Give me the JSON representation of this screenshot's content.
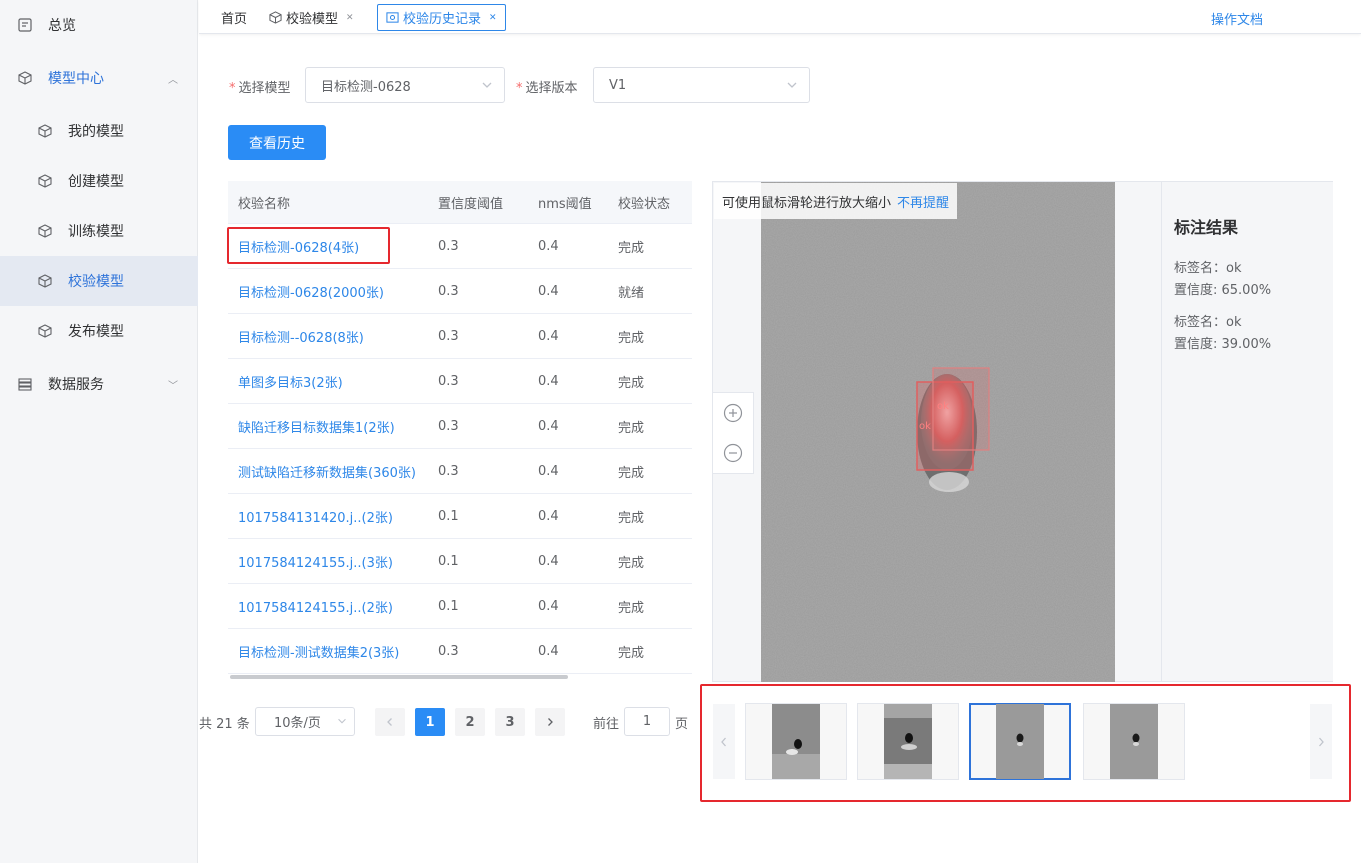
{
  "sidebar": {
    "overview": "总览",
    "model_center": "模型中心",
    "items": [
      {
        "label": "我的模型",
        "icon": "cube-icon"
      },
      {
        "label": "创建模型",
        "icon": "cube-plus-icon"
      },
      {
        "label": "训练模型",
        "icon": "cube-icon"
      },
      {
        "label": "校验模型",
        "icon": "cube-check-icon"
      },
      {
        "label": "发布模型",
        "icon": "cube-icon"
      }
    ],
    "data_service": "数据服务"
  },
  "tabs": {
    "home": "首页",
    "verify_model": "校验模型",
    "history": "校验历史记录",
    "doc_link": "操作文档"
  },
  "form": {
    "model_label": "选择模型",
    "model_value": "目标检测-0628",
    "version_label": "选择版本",
    "version_value": "V1",
    "query_button": "查看历史"
  },
  "table": {
    "headers": [
      "校验名称",
      "置信度阈值",
      "nms阈值",
      "校验状态"
    ],
    "rows": [
      {
        "name": "目标检测-0628(4张)",
        "conf": "0.3",
        "nms": "0.4",
        "status": "完成"
      },
      {
        "name": "目标检测-0628(2000张)",
        "conf": "0.3",
        "nms": "0.4",
        "status": "就绪"
      },
      {
        "name": "目标检测--0628(8张)",
        "conf": "0.3",
        "nms": "0.4",
        "status": "完成"
      },
      {
        "name": "单图多目标3(2张)",
        "conf": "0.3",
        "nms": "0.4",
        "status": "完成"
      },
      {
        "name": "缺陷迁移目标数据集1(2张)",
        "conf": "0.3",
        "nms": "0.4",
        "status": "完成"
      },
      {
        "name": "测试缺陷迁移新数据集(360张)",
        "conf": "0.3",
        "nms": "0.4",
        "status": "完成"
      },
      {
        "name": "1017584131420.j..(2张)",
        "conf": "0.1",
        "nms": "0.4",
        "status": "完成"
      },
      {
        "name": "1017584124155.j..(3张)",
        "conf": "0.1",
        "nms": "0.4",
        "status": "完成"
      },
      {
        "name": "1017584124155.j..(2张)",
        "conf": "0.1",
        "nms": "0.4",
        "status": "完成"
      },
      {
        "name": "目标检测-测试数据集2(3张)",
        "conf": "0.3",
        "nms": "0.4",
        "status": "完成"
      }
    ]
  },
  "pagination": {
    "total": "共 21 条",
    "page_size": "10条/页",
    "pages": [
      "1",
      "2",
      "3"
    ],
    "current": "1",
    "goto_label": "前往",
    "goto_value": "1",
    "page_suffix": "页"
  },
  "viewer": {
    "tip": "可使用鼠标滑轮进行放大缩小",
    "tip_dismiss": "不再提醒",
    "box_label": "ok",
    "result_title": "标注结果",
    "results": [
      {
        "label": "标签名：ok",
        "confidence": "置信度: 65.00%"
      },
      {
        "label": "标签名：ok",
        "confidence": "置信度: 39.00%"
      }
    ]
  },
  "thumbnails": {
    "count": 4,
    "selected_index": 2
  }
}
